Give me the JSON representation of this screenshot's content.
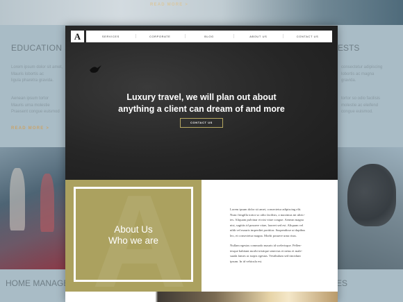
{
  "background": {
    "top_read_more": "READ MORE >",
    "heading_left": "EDUCATION SPECIALISTS",
    "heading_right": "ESTS",
    "text_left_1": "Lorem ipsum dolor sit amet,\nMauris lobortis ac\nligula pharetra gravida.",
    "text_left_2": "Aenean ipsum tortor\nMauris urna molestie\nPraesent congue euismod",
    "text_right_1": "consectetur adipiscing\nlobortis ac magna\ngravida.",
    "text_right_2": "tortor so odio facilisis\nmolestie ac eleifend\ncongue euismod.",
    "read_more_left": "READ MORE >",
    "heading_bottom_left": "HOME MANAGEMENTS",
    "heading_bottom_right": "ES"
  },
  "nav": {
    "logo": "A",
    "items": [
      "SERVICES",
      "CORPORATE",
      "BLOG",
      "ABOUT US",
      "CONTACT US"
    ]
  },
  "hero": {
    "title": "Luxury travel, we will plan out about\nanything a client can dream of and more",
    "button": "CONTACT US"
  },
  "about": {
    "big_letter": "A",
    "title": "About Us\nWho we are",
    "paragraph_1": "Lorem ipsum dolor sit amet, consectetur adipiscing elit.\nNunc fringilla tortor so odio facilisis, a maximus mi ultric-\nies. Aliquam pulvinar et nisi vitae congue. Aenean magna\nnisi, sagittis id posuere vitae, laoreet sed est. Aliquam vel\nnibh vel mauris imperdiet porttitor. Suspendisse ut dapibus\nleo, et consectetur magna. Morbi posuere urna risus.",
    "paragraph_2": "Nullam egestas commodo mauris id scelerisque. Pellen-\ntesque habitant morbi tristique senectus et netus et male-\nsuada fames ac turpis egestas. Vestibulum sed tincidunt\nipsum. In id vehicula est."
  },
  "colors": {
    "accent_gold": "#aba15f",
    "hero_dark": "#262626",
    "background": "#a9bcc6"
  }
}
